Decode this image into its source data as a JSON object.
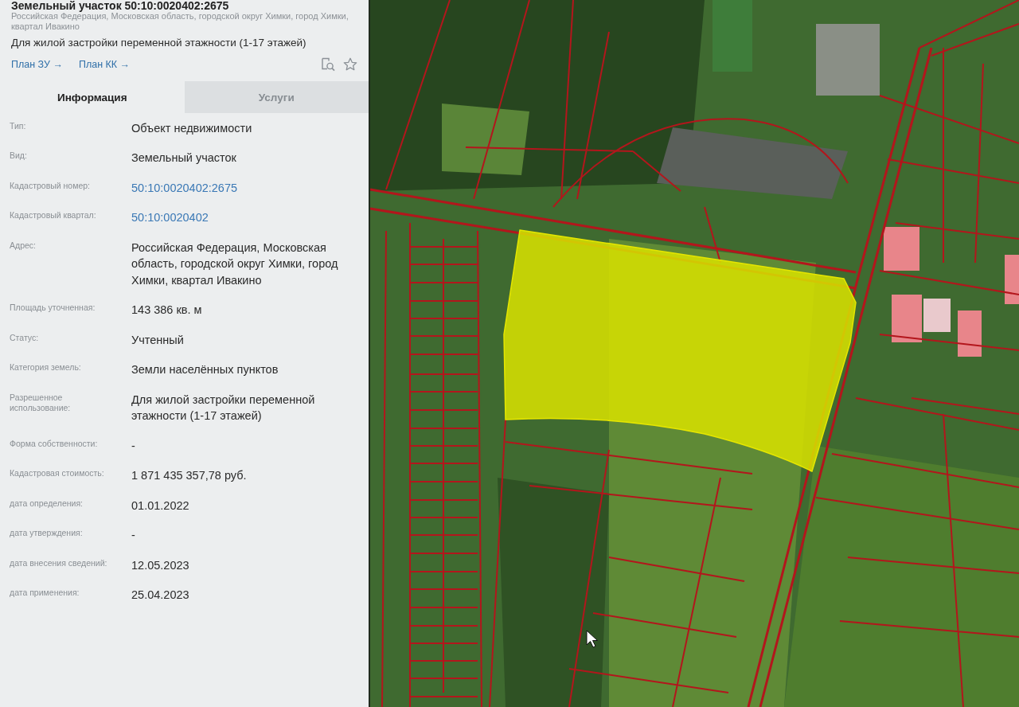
{
  "panel": {
    "title": "Земельный участок 50:10:0020402:2675",
    "address": "Российская Федерация, Московская область, городской округ Химки, город Химки, квартал Ивакино",
    "purpose": "Для жилой застройки переменной этажности (1-17 этажей)",
    "links": [
      "План ЗУ →",
      "План КК →"
    ],
    "tabs": [
      {
        "label": "Информация",
        "selected": true
      },
      {
        "label": "Услуги",
        "selected": false
      }
    ],
    "attributes": [
      {
        "label": "Тип:",
        "value": "Объект недвижимости",
        "kind": "text"
      },
      {
        "label": "Вид:",
        "value": "Земельный участок",
        "kind": "text"
      },
      {
        "label": "Кадастровый номер:",
        "value": "50:10:0020402:2675",
        "kind": "link"
      },
      {
        "label": "Кадастровый квартал:",
        "value": "50:10:0020402",
        "kind": "link"
      },
      {
        "label": "Адрес:",
        "value": "Российская Федерация, Московская область, городской округ Химки, город Химки, квартал Ивакино",
        "kind": "text"
      },
      {
        "label": "Площадь уточненная:",
        "value": "143 386 кв. м",
        "kind": "text"
      },
      {
        "label": "Статус:",
        "value": "Учтенный",
        "kind": "text"
      },
      {
        "label": "Категория земель:",
        "value": "Земли населённых пунктов",
        "kind": "text"
      },
      {
        "label": "Разрешенное использование:",
        "value": "Для жилой застройки переменной этажности (1-17 этажей)",
        "kind": "text"
      },
      {
        "label": "Форма собственности:",
        "value": "-",
        "kind": "text"
      },
      {
        "label": "Кадастровая стоимость:",
        "value": "1 871 435 357,78 руб.",
        "kind": "text"
      },
      {
        "label": "дата определения:",
        "value": "01.01.2022",
        "kind": "text"
      },
      {
        "label": "дата утверждения:",
        "value": "-",
        "kind": "text"
      },
      {
        "label": "дата внесения сведений:",
        "value": "12.05.2023",
        "kind": "text"
      },
      {
        "label": "дата применения:",
        "value": "25.04.2023",
        "kind": "text"
      }
    ]
  }
}
